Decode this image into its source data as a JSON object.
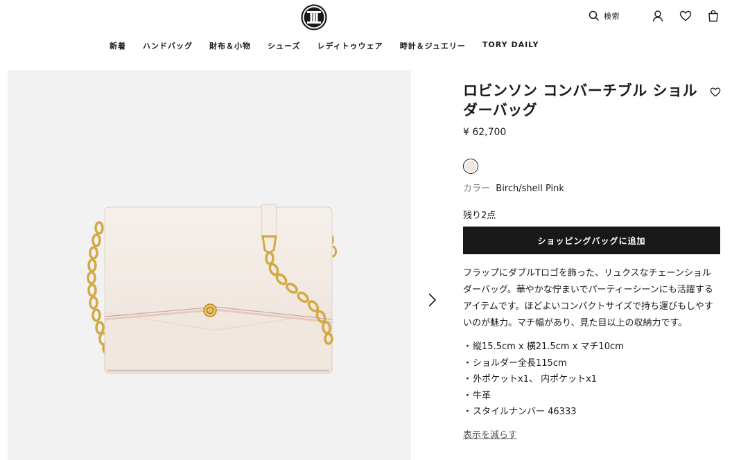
{
  "header": {
    "search_label": "検索",
    "icons": [
      "search-icon",
      "account-icon",
      "heart-icon",
      "shopping-bag-icon"
    ]
  },
  "nav": {
    "items": [
      "新着",
      "ハンドバッグ",
      "財布＆小物",
      "シューズ",
      "レディトゥウェア",
      "時計＆ジュエリー",
      "TORY DAILY"
    ]
  },
  "product": {
    "title": "ロビンソン コンバーチブル ショルダーバッグ",
    "price": "¥ 62,700",
    "color_label": "カラー",
    "color_value": "Birch/shell Pink",
    "swatch_color": "#f1e7df",
    "stock": "残り2点",
    "add_to_bag": "ショッピングバッグに追加",
    "description": "フラップにダブルTロゴを飾った、リュクスなチェーンショルダーバッグ。華やかな佇まいでパーティーシーンにも活躍するアイテムです。ほどよいコンパクトサイズで持ち運びもしやすいのが魅力。マチ幅があり、見た目以上の収納力です。",
    "specs": [
      "縦15.5cm x 横21.5cm x マチ10cm",
      "ショルダー全長115cm",
      "外ポケットx1、 内ポケットx1",
      "牛革",
      "スタイルナンバー 46333"
    ],
    "show_less": "表示を減らす"
  },
  "colors": {
    "button_bg": "#181818",
    "gallery_bg": "#f2f2f2",
    "bag": "#f3ece5",
    "gold": "#d4a945"
  }
}
